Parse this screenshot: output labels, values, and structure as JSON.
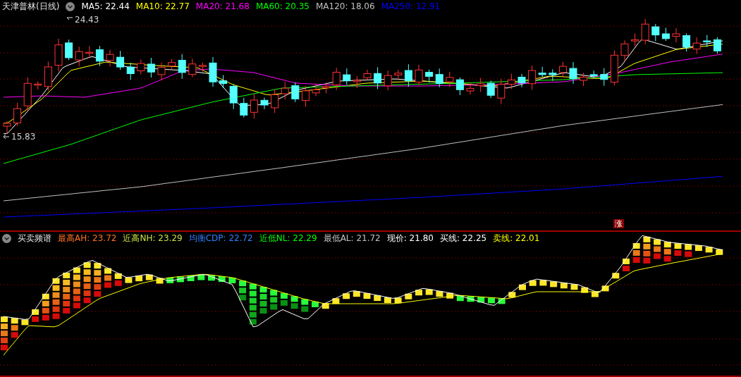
{
  "main_chart": {
    "title": "天津普林(日线)",
    "indicators": [
      {
        "label": "MA5: 22.44",
        "color": "#ffffff"
      },
      {
        "label": "MA10: 22.77",
        "color": "#ffff00"
      },
      {
        "label": "MA20: 21.68",
        "color": "#ff00ff"
      },
      {
        "label": "MA60: 20.35",
        "color": "#00ff00"
      },
      {
        "label": "MA120: 18.06",
        "color": "#c0c0c0"
      },
      {
        "label": "MA250: 12.91",
        "color": "#0000ff"
      }
    ],
    "high_marker": "24.43",
    "low_marker": "15.83",
    "badge": "涨"
  },
  "sub_chart": {
    "title": "买卖频谱",
    "indicators": [
      {
        "label": "最高AH: 23.72",
        "color": "#ff7020"
      },
      {
        "label": "近高NH: 23.29",
        "color": "#c8e040"
      },
      {
        "label": "均衡CDP: 22.72",
        "color": "#2f80ff"
      },
      {
        "label": "近低NL: 22.29",
        "color": "#00ff00"
      },
      {
        "label": "最低AL: 21.72",
        "color": "#c0c0c0"
      },
      {
        "label": "现价: 21.80",
        "color": "#ffffff"
      },
      {
        "label": "买线: 22.25",
        "color": "#ffffff"
      },
      {
        "label": "卖线: 22.01",
        "color": "#ffff00"
      }
    ]
  }
}
